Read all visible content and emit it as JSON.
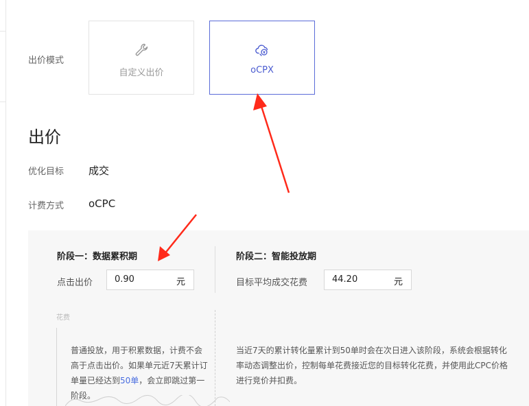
{
  "mode": {
    "label": "出价模式",
    "options": [
      {
        "label": "自定义出价",
        "icon": "wrench-icon",
        "selected": false
      },
      {
        "label": "oCPX",
        "icon": "cloud-coin-icon",
        "selected": true
      }
    ]
  },
  "bid": {
    "title": "出价",
    "goal_label": "优化目标",
    "goal_value": "成交",
    "billing_label": "计费方式",
    "billing_value": "oCPC"
  },
  "stage1": {
    "title": "阶段一：数据累积期",
    "field_label": "点击出价",
    "value": "0.90",
    "unit": "元",
    "desc_a": "普通投放，用于积累数据，计费不会",
    "desc_b": "高于点击出价。如果单元近7天累计订",
    "desc_c": "单量已经达到",
    "desc_link": "50单",
    "desc_d": "，会立即跳过第一",
    "desc_e": "阶段。"
  },
  "stage2": {
    "title": "阶段二：智能投放期",
    "field_label": "目标平均成交花费",
    "value": "44.20",
    "unit": "元",
    "desc_a": "当近7天的累计转化量累计到50单时会在次日进入该阶段，系统会根据转化",
    "desc_b": "率动态调整出价，控制每单花费接近您的目标转化花费，并使用此CPC价格",
    "desc_c": "进行竞价并扣费。"
  },
  "chart": {
    "cost_label": "花费"
  },
  "colors": {
    "accent": "#4a5bd0",
    "arrow": "#ff2a1a",
    "panel": "#f7f7f7"
  }
}
